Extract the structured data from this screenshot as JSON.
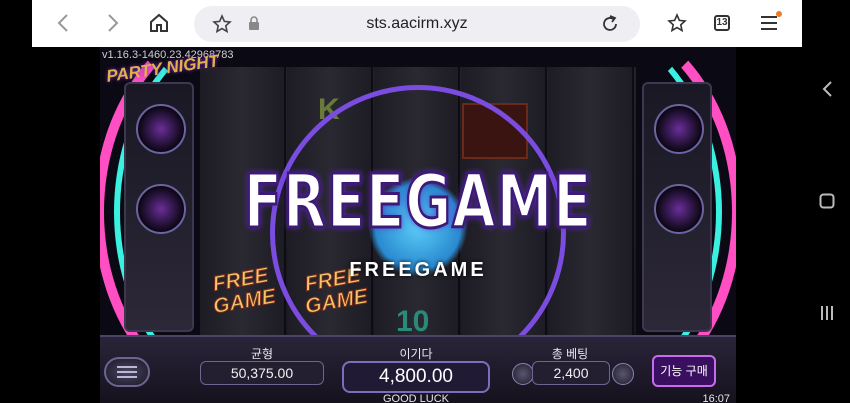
{
  "browser": {
    "url": "sts.aacirm.xyz",
    "tab_count": "13"
  },
  "game": {
    "version": "v1.16.3-1460.23.42968783",
    "logo_text": "PARTY NIGHT",
    "banner_title": "FREEGAME",
    "banner_subtitle": "FREEGAME",
    "reel_symbols": [
      "K",
      "10"
    ],
    "scatter_symbol_line1": "FREE",
    "scatter_symbol_line2": "GAME"
  },
  "panel": {
    "balance_label": "균형",
    "balance_value": "50,375.00",
    "win_label": "이기다",
    "win_value": "4,800.00",
    "bet_label": "총 베팅",
    "bet_value": "2,400",
    "buy_feature_label": "기능 구매",
    "status_text": "GOOD LUCK",
    "clock": "16:07"
  },
  "colors": {
    "ring_pink": "#ff4fc3",
    "ring_cyan": "#39f0e1",
    "ring_purple": "#7a4de0",
    "buy_border": "#c76cf0"
  }
}
